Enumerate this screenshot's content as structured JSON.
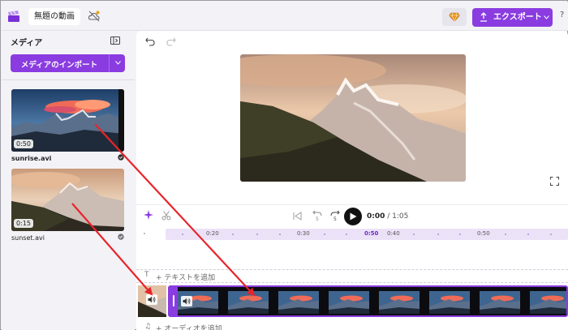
{
  "header": {
    "project_title": "無題の動画",
    "export_label": "エクスポート",
    "help": "?"
  },
  "media": {
    "title": "メディア",
    "import_label": "メディアのインポート",
    "items": [
      {
        "duration": "0:50",
        "filename": "sunrise.avi",
        "selected": true
      },
      {
        "duration": "0:15",
        "filename": "sunset.avi",
        "selected": false
      }
    ]
  },
  "player": {
    "current_time": "0:00",
    "separator": " / ",
    "total_time": "1:05",
    "rewind_label": "5",
    "forward_label": "5"
  },
  "timeline": {
    "ticks": [
      "0:20",
      "0:30",
      "0:50",
      "0:40",
      "0:50"
    ],
    "active_tick": "0:50",
    "text_track_icon": "T",
    "text_track_label": "+ テキストを追加",
    "audio_track_icon": "♫",
    "audio_track_label": "+ オーディオを追加"
  },
  "colors": {
    "accent": "#8a3ce0",
    "arrow": "#e8242b"
  }
}
